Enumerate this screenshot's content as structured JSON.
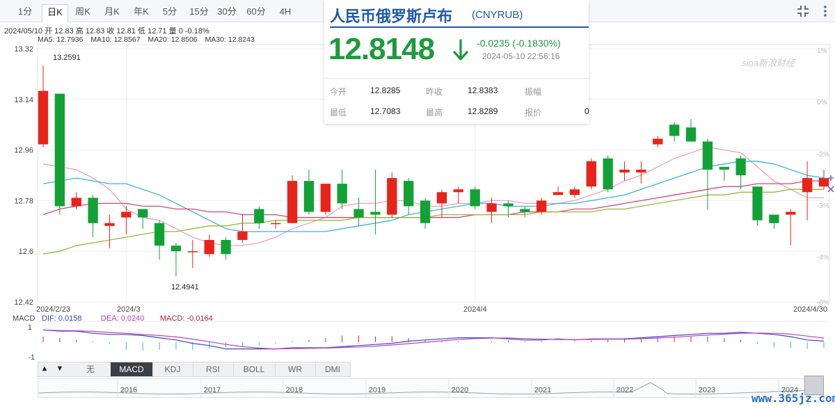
{
  "period_tabs": [
    {
      "label": "1分",
      "active": false
    },
    {
      "label": "日K",
      "active": true
    },
    {
      "label": "周K",
      "active": false
    },
    {
      "label": "月K",
      "active": false
    },
    {
      "label": "年K",
      "active": false
    },
    {
      "label": "5分",
      "active": false
    },
    {
      "label": "15分",
      "active": false
    },
    {
      "label": "30分",
      "active": false
    },
    {
      "label": "60分",
      "active": false
    },
    {
      "label": "4H",
      "active": false
    }
  ],
  "ohlc_line": "2024/05/10 开 12.83 高 12.83 收 12.81 低 12.71 量 0 -0.18%",
  "ma_labels": [
    {
      "text": "MA5: 12.7936",
      "color": "#f19ec2"
    },
    {
      "text": "MA10: 12.8567",
      "color": "#3cb4d6"
    },
    {
      "text": "MA20: 12.8506",
      "color": "#d04a7c"
    },
    {
      "text": "MA30: 12.8243",
      "color": "#9ab83a"
    }
  ],
  "popup": {
    "title": "人民币俄罗斯卢布",
    "code": "(CNYRUB)",
    "price": "12.8148",
    "change": "-0.0235 (-0.1830%)",
    "time": "2024-05-10 22:56:16",
    "labels": [
      "今开",
      "昨收",
      "振幅",
      "最低",
      "最高",
      "报价"
    ],
    "values": [
      "12.8285",
      "12.8383",
      "",
      "12.7083",
      "12.8289",
      "0"
    ]
  },
  "watermark": "sina新浪财经",
  "site_watermark": "www.365jz.com",
  "indicator_tabs": [
    {
      "label": "无",
      "active": false
    },
    {
      "label": "MACD",
      "active": true
    },
    {
      "label": "KDJ",
      "active": false
    },
    {
      "label": "RSI",
      "active": false
    },
    {
      "label": "BOLL",
      "active": false
    },
    {
      "label": "WR",
      "active": false
    },
    {
      "label": "DMI",
      "active": false
    }
  ],
  "arrows": {
    "up": "▲",
    "down": "▼"
  },
  "chart_data": [
    {
      "type": "candlestick",
      "ylim": [
        12.42,
        13.32
      ],
      "y_ticks": [
        "13.32",
        "13.14",
        "12.96",
        "12.78",
        "12.6",
        "12.42"
      ],
      "right_ticks": [
        "1%",
        "0%",
        "-2%",
        "-3%",
        "-4%",
        "-6%"
      ],
      "x_tick_labels": [
        "2024/2/23",
        "2024/3",
        "2024/4",
        "2024/4/30"
      ],
      "high_annotation": "13.2591",
      "low_annotation": "12.4941",
      "up_color": "#e8231a",
      "down_color": "#13a136",
      "candles": [
        [
          12.98,
          13.17,
          13.26,
          12.97
        ],
        [
          13.16,
          12.76,
          13.16,
          12.73
        ],
        [
          12.76,
          12.79,
          12.81,
          12.75
        ],
        [
          12.79,
          12.7,
          12.8,
          12.65
        ],
        [
          12.69,
          12.7,
          12.73,
          12.61
        ],
        [
          12.72,
          12.74,
          12.76,
          12.66
        ],
        [
          12.75,
          12.72,
          12.75,
          12.68
        ],
        [
          12.7,
          12.62,
          12.71,
          12.57
        ],
        [
          12.62,
          12.6,
          12.63,
          12.51
        ],
        [
          12.6,
          12.6,
          12.64,
          12.54
        ],
        [
          12.59,
          12.64,
          12.66,
          12.58
        ],
        [
          12.64,
          12.59,
          12.65,
          12.57
        ],
        [
          12.64,
          12.67,
          12.73,
          12.63
        ],
        [
          12.75,
          12.7,
          12.76,
          12.68
        ],
        [
          12.7,
          12.7,
          12.71,
          12.68
        ],
        [
          12.7,
          12.85,
          12.87,
          12.7
        ],
        [
          12.85,
          12.74,
          12.89,
          12.73
        ],
        [
          12.74,
          12.84,
          12.84,
          12.73
        ],
        [
          12.84,
          12.77,
          12.89,
          12.75
        ],
        [
          12.75,
          12.72,
          12.79,
          12.69
        ],
        [
          12.74,
          12.73,
          12.89,
          12.66
        ],
        [
          12.73,
          12.86,
          12.88,
          12.72
        ],
        [
          12.85,
          12.76,
          12.86,
          12.73
        ],
        [
          12.78,
          12.7,
          12.79,
          12.68
        ],
        [
          12.77,
          12.81,
          12.82,
          12.72
        ],
        [
          12.81,
          12.82,
          12.83,
          12.77
        ],
        [
          12.82,
          12.76,
          12.83,
          12.75
        ],
        [
          12.74,
          12.77,
          12.79,
          12.7
        ],
        [
          12.77,
          12.76,
          12.78,
          12.72
        ],
        [
          12.75,
          12.74,
          12.76,
          12.72
        ],
        [
          12.74,
          12.78,
          12.79,
          12.73
        ],
        [
          12.8,
          12.81,
          12.83,
          12.8
        ],
        [
          12.8,
          12.82,
          12.83,
          12.79
        ],
        [
          12.83,
          12.92,
          12.93,
          12.82
        ],
        [
          12.93,
          12.82,
          12.94,
          12.81
        ],
        [
          12.88,
          12.89,
          12.92,
          12.85
        ],
        [
          12.88,
          12.89,
          12.92,
          12.84
        ],
        [
          12.98,
          13.0,
          13.01,
          12.97
        ],
        [
          13.05,
          13.01,
          13.06,
          12.99
        ],
        [
          13.04,
          12.99,
          13.07,
          12.99
        ],
        [
          12.99,
          12.89,
          13.0,
          12.75
        ],
        [
          12.9,
          12.89,
          12.9,
          12.85
        ],
        [
          12.93,
          12.87,
          12.94,
          12.82
        ],
        [
          12.83,
          12.71,
          12.83,
          12.69
        ],
        [
          12.73,
          12.7,
          12.73,
          12.68
        ],
        [
          12.73,
          12.74,
          12.75,
          12.62
        ],
        [
          12.81,
          12.86,
          12.92,
          12.71
        ],
        [
          12.83,
          12.86,
          12.89,
          12.82
        ]
      ],
      "ma_series": [
        {
          "name": "MA5",
          "values": [
            12.91,
            12.9,
            12.89,
            12.86,
            12.82,
            12.75,
            12.72,
            12.71,
            12.68,
            12.65,
            12.63,
            12.62,
            12.62,
            12.63,
            12.65,
            12.68,
            12.7,
            12.72,
            12.76,
            12.77,
            12.77,
            12.78,
            12.78,
            12.76,
            12.76,
            12.77,
            12.77,
            12.78,
            12.78,
            12.77,
            12.77,
            12.77,
            12.78,
            12.8,
            12.82,
            12.85,
            12.87,
            12.9,
            12.93,
            12.95,
            12.97,
            12.96,
            12.95,
            12.9,
            12.85,
            12.82,
            12.79,
            12.79
          ]
        },
        {
          "name": "MA10",
          "values": [
            12.84,
            12.85,
            12.86,
            12.85,
            12.84,
            12.84,
            12.82,
            12.8,
            12.77,
            12.74,
            12.71,
            12.68,
            12.67,
            12.67,
            12.67,
            12.67,
            12.67,
            12.67,
            12.68,
            12.69,
            12.7,
            12.71,
            12.73,
            12.74,
            12.75,
            12.76,
            12.77,
            12.77,
            12.76,
            12.76,
            12.76,
            12.77,
            12.77,
            12.78,
            12.79,
            12.8,
            12.82,
            12.84,
            12.86,
            12.88,
            12.9,
            12.91,
            12.92,
            12.92,
            12.91,
            12.89,
            12.87,
            12.86
          ]
        },
        {
          "name": "MA20",
          "values": [
            12.73,
            12.75,
            12.76,
            12.77,
            12.77,
            12.77,
            12.76,
            12.76,
            12.75,
            12.75,
            12.74,
            12.74,
            12.73,
            12.73,
            12.73,
            12.72,
            12.72,
            12.72,
            12.72,
            12.72,
            12.72,
            12.72,
            12.72,
            12.72,
            12.72,
            12.72,
            12.73,
            12.73,
            12.73,
            12.74,
            12.74,
            12.74,
            12.75,
            12.75,
            12.76,
            12.77,
            12.78,
            12.79,
            12.8,
            12.81,
            12.82,
            12.83,
            12.83,
            12.84,
            12.84,
            12.84,
            12.85,
            12.85
          ]
        },
        {
          "name": "MA30",
          "values": [
            12.59,
            12.6,
            12.62,
            12.63,
            12.64,
            12.65,
            12.66,
            12.67,
            12.67,
            12.68,
            12.69,
            12.69,
            12.7,
            12.7,
            12.71,
            12.71,
            12.71,
            12.71,
            12.71,
            12.72,
            12.72,
            12.72,
            12.72,
            12.72,
            12.73,
            12.73,
            12.73,
            12.73,
            12.73,
            12.73,
            12.74,
            12.74,
            12.74,
            12.74,
            12.75,
            12.75,
            12.76,
            12.77,
            12.78,
            12.79,
            12.8,
            12.8,
            12.81,
            12.81,
            12.81,
            12.82,
            12.82,
            12.82
          ]
        }
      ]
    },
    {
      "type": "macd",
      "label": "MACD",
      "dif_label": "DIF: 0.0158",
      "dea_label": "DEA: 0.0240",
      "macd_label": "MACD: -0.0164",
      "y_ticks": [
        "1",
        "-1"
      ],
      "dif_color": "#3c46c8",
      "dea_color": "#c040c0",
      "macd_color": "#b8222a"
    },
    {
      "type": "area",
      "title": "navigator",
      "x_tick_labels": [
        "2016",
        "2017",
        "2018",
        "2019",
        "2020",
        "2021",
        "2022",
        "2023",
        "2024"
      ]
    }
  ]
}
